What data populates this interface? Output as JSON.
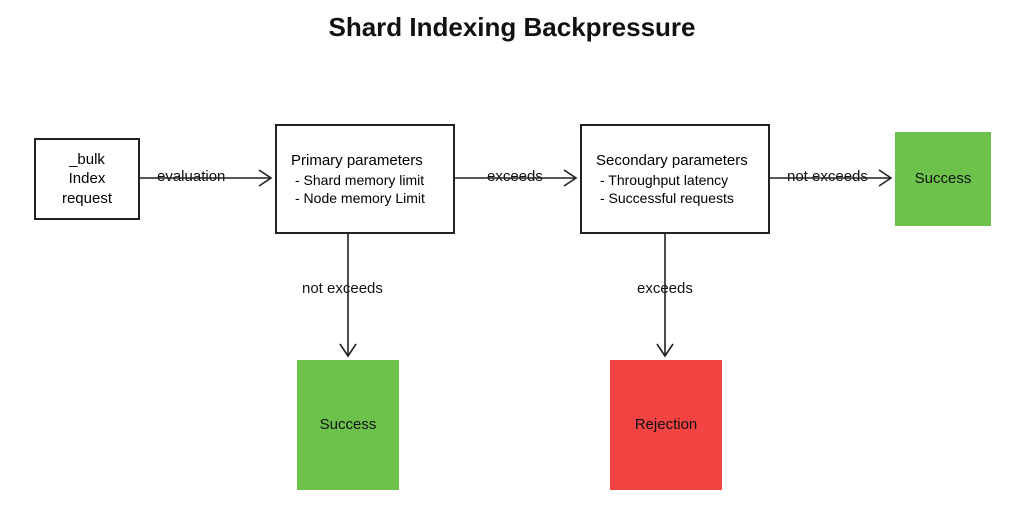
{
  "title": "Shard Indexing Backpressure",
  "nodes": {
    "bulk": {
      "line1": "_bulk",
      "line2": "Index",
      "line3": "request"
    },
    "primary": {
      "header": "Primary parameters",
      "b1": "- Shard memory limit",
      "b2": "- Node memory Limit"
    },
    "secondary": {
      "header": "Secondary parameters",
      "b1": "- Throughput latency",
      "b2": "- Successful requests"
    },
    "success1": "Success",
    "success2": "Success",
    "rejection": "Rejection"
  },
  "edges": {
    "evaluation": "evaluation",
    "exceeds_right": "exceeds",
    "not_exceeds_right": "not exceeds",
    "not_exceeds_down": "not exceeds",
    "exceeds_down": "exceeds"
  }
}
